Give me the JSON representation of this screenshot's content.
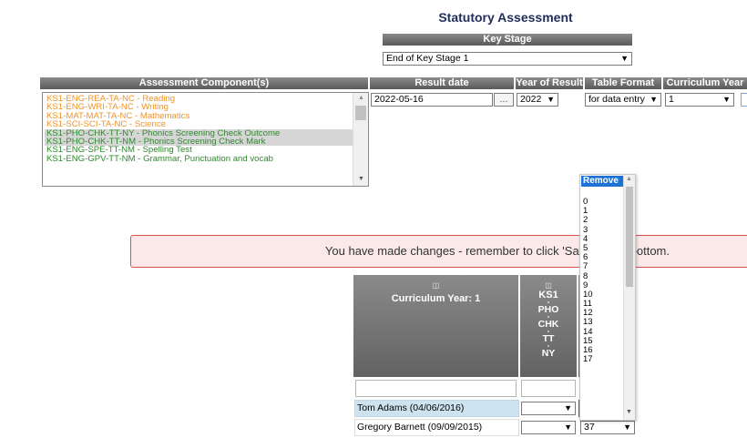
{
  "page_title": "Statutory Assessment",
  "key_stage": {
    "header": "Key Stage",
    "value": "End of Key Stage 1"
  },
  "columns": {
    "component": "Assessment Component(s)",
    "result_date": "Result date",
    "year_of_result": "Year of Result",
    "table_format": "Table Format",
    "curriculum_year": "Curriculum Year"
  },
  "components": [
    {
      "label": "KS1-ENG-REA-TA-NC - Reading",
      "color": "#f0932b",
      "selected": false
    },
    {
      "label": "KS1-ENG-WRI-TA-NC - Writing",
      "color": "#f0932b",
      "selected": false
    },
    {
      "label": "KS1-MAT-MAT-TA-NC - Mathematics",
      "color": "#f0932b",
      "selected": false
    },
    {
      "label": "KS1-SCI-SCI-TA-NC - Science",
      "color": "#f0932b",
      "selected": false
    },
    {
      "label": "KS1-PHO-CHK-TT-NY - Phonics Screening Check Outcome",
      "color": "#2d8a2d",
      "selected": true
    },
    {
      "label": "KS1-PHO-CHK-TT-NM - Phonics Screening Check Mark",
      "color": "#2d8a2d",
      "selected": true
    },
    {
      "label": "KS1-ENG-SPE-TT-NM - Spelling Test",
      "color": "#2d8a2d",
      "selected": false
    },
    {
      "label": "KS1-ENG-GPV-TT-NM - Grammar, Punctuation and vocab",
      "color": "#2d8a2d",
      "selected": false
    }
  ],
  "result_date": {
    "value": "2022-05-16",
    "picker": "..."
  },
  "year_of_result": {
    "value": "2022"
  },
  "table_format": {
    "value": "for data entry"
  },
  "curriculum_year": {
    "value": "1"
  },
  "warning": "You have made changes - remember to click 'Save' at the bottom.",
  "grid": {
    "header_left": "Curriculum Year: 1",
    "col1": [
      "KS1",
      "-",
      "PHO",
      "-",
      "CHK",
      "-",
      "TT",
      "-",
      "NY"
    ],
    "rows": [
      {
        "name": "Tom Adams (04/06/2016)",
        "val1": "",
        "val2": ""
      },
      {
        "name": "Gregory Barnett (09/09/2015)",
        "val1": "",
        "val2": "37"
      }
    ]
  },
  "dropdown": {
    "selected": "Remove",
    "options": [
      "0",
      "1",
      "2",
      "3",
      "4",
      "5",
      "6",
      "7",
      "8",
      "9",
      "10",
      "11",
      "12",
      "13",
      "14",
      "15",
      "16",
      "17"
    ]
  },
  "colors": {
    "header": "#5a5a5a",
    "orange": "#f0932b",
    "green": "#2d8a2d",
    "highlight": "#1e72d3",
    "warning_border": "#d9534f"
  }
}
